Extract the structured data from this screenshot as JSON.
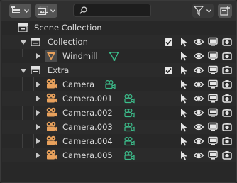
{
  "header": {
    "display_mode_icon": "outliner-list-icon",
    "filter_icon": "funnel-icon",
    "new_collection_icon": "new-collection-icon",
    "search": {
      "value": "",
      "placeholder": ""
    }
  },
  "tree": [
    {
      "label": "Scene Collection",
      "icon": "scene-collection-icon",
      "level": 0
    },
    {
      "label": "Collection",
      "icon": "collection-icon",
      "level": 1,
      "expanded": true,
      "checked": true
    },
    {
      "label": "Windmill",
      "icon": "mesh-object-icon",
      "level": 2,
      "expanded": false,
      "modifier_icon": "mesh-data-icon"
    },
    {
      "label": "Extra",
      "icon": "collection-icon",
      "level": 1,
      "expanded": true,
      "checked": true
    },
    {
      "label": "Camera",
      "icon": "camera-object-icon",
      "level": 2,
      "expanded": false,
      "data_icon": "camera-data-icon"
    },
    {
      "label": "Camera.001",
      "icon": "camera-object-icon",
      "level": 2,
      "expanded": false,
      "data_icon": "camera-data-icon"
    },
    {
      "label": "Camera.002",
      "icon": "camera-object-icon",
      "level": 2,
      "expanded": false,
      "data_icon": "camera-data-icon"
    },
    {
      "label": "Camera.003",
      "icon": "camera-object-icon",
      "level": 2,
      "expanded": false,
      "data_icon": "camera-data-icon"
    },
    {
      "label": "Camera.004",
      "icon": "camera-object-icon",
      "level": 2,
      "expanded": false,
      "data_icon": "camera-data-icon"
    },
    {
      "label": "Camera.005",
      "icon": "camera-object-icon",
      "level": 2,
      "expanded": false,
      "data_icon": "camera-data-icon"
    }
  ],
  "restriction_icons": [
    "select-arrow-icon",
    "eye-icon",
    "monitor-icon",
    "camera-render-icon"
  ],
  "colors": {
    "background": "#282828",
    "header": "#303030",
    "object_orange": "#e8a15c",
    "data_green": "#3cbf8c",
    "text": "#dcdcdc"
  }
}
